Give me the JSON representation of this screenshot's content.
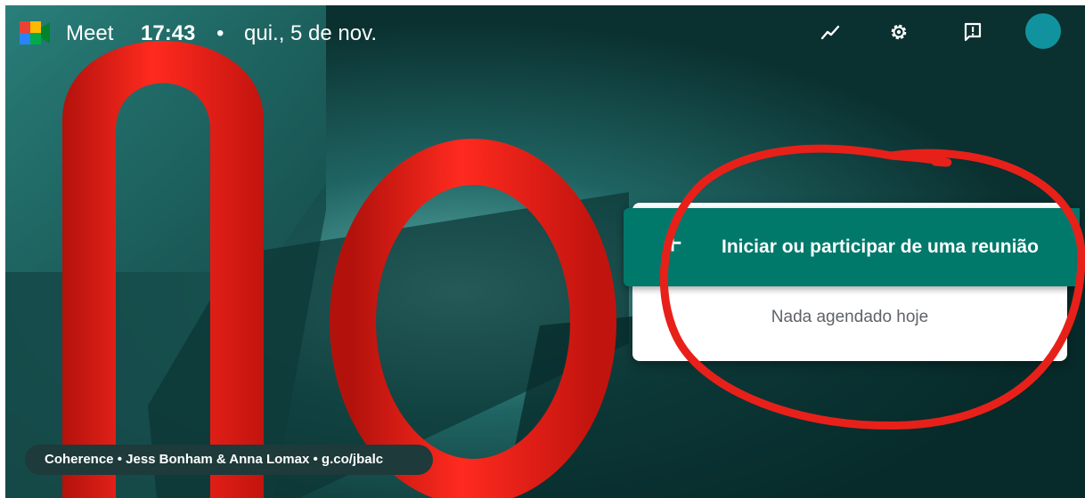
{
  "header": {
    "app_name": "Meet",
    "time": "17:43",
    "separator": "•",
    "date": "qui., 5 de nov.",
    "icons": [
      "activity-trend-icon",
      "settings-gear-icon",
      "feedback-icon",
      "account-avatar"
    ]
  },
  "main": {
    "join_button_icon": "+",
    "join_button_label": "Iniciar ou participar de uma reunião",
    "schedule_empty_text": "Nada agendado hoje"
  },
  "background_credit": {
    "title": "Coherence",
    "authors": "Jess Bonham & Anna Lomax",
    "link": "g.co/jbalc",
    "separator": "•"
  },
  "colors": {
    "primary_green": "#00796b",
    "avatar": "#11939f",
    "annotation_red": "#e8201a"
  }
}
